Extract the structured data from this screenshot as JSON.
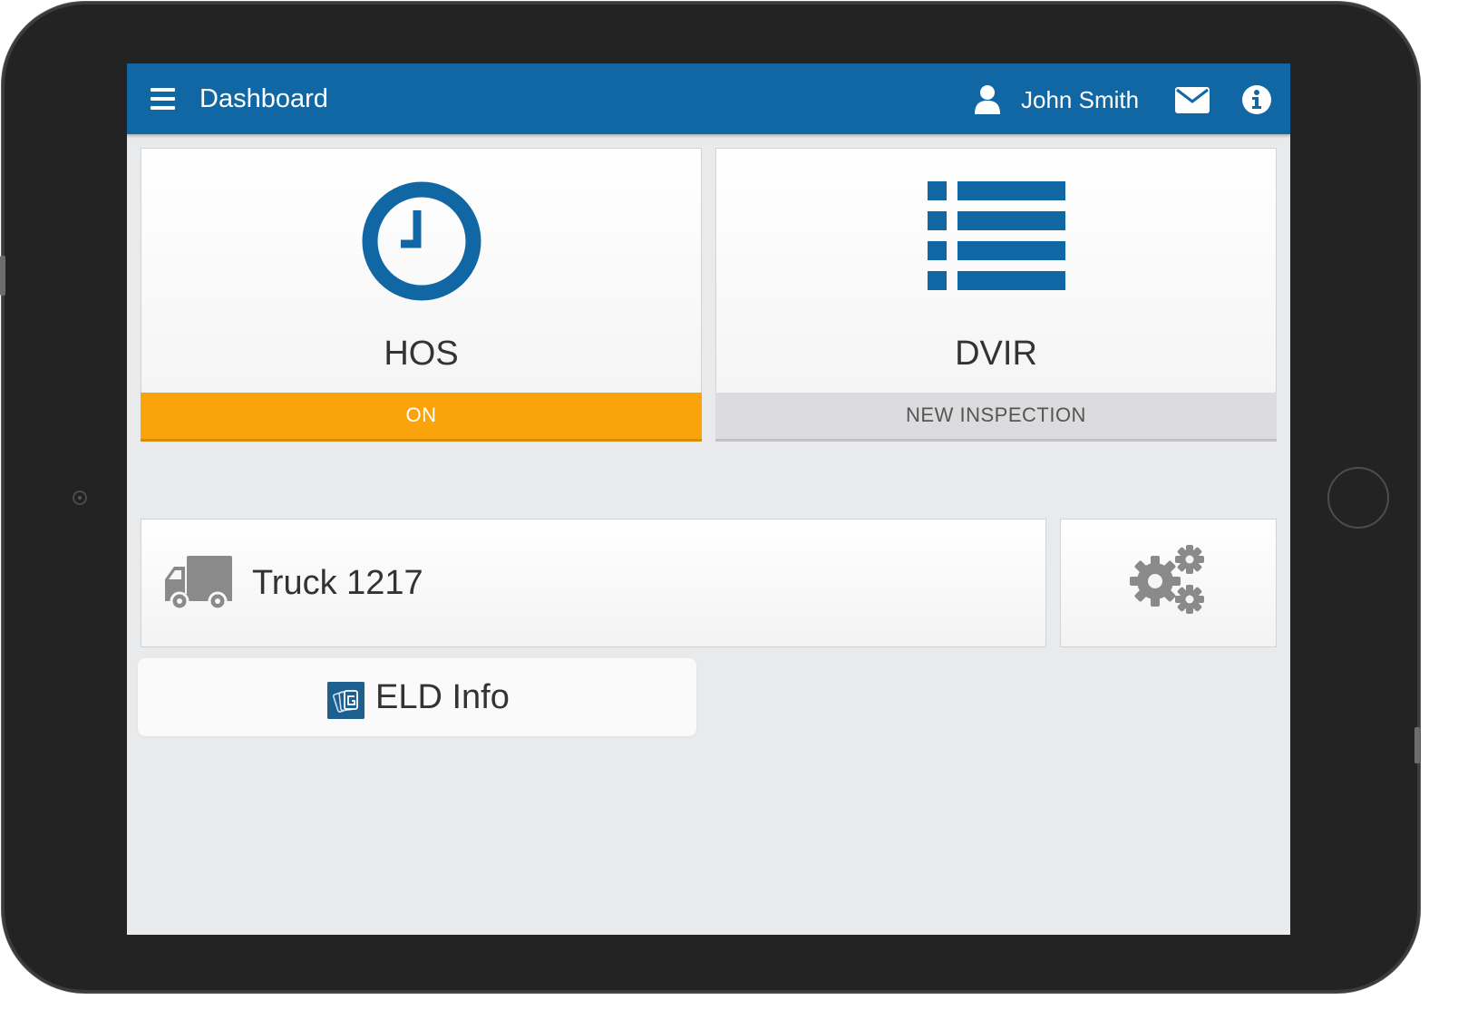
{
  "header": {
    "title": "Dashboard",
    "user_name": "John Smith",
    "icons": [
      "menu-icon",
      "user-icon",
      "mail-icon",
      "info-icon"
    ]
  },
  "tiles": {
    "hos": {
      "label": "HOS",
      "status": "ON",
      "icon": "clock-icon"
    },
    "dvir": {
      "label": "DVIR",
      "status": "NEW INSPECTION",
      "icon": "list-icon"
    }
  },
  "vehicle": {
    "label": "Truck 1217",
    "icon": "truck-icon"
  },
  "settings": {
    "icon": "gears-icon"
  },
  "eld": {
    "label": "ELD Info",
    "icon": "eld-logo-icon"
  },
  "colors": {
    "header_bg": "#1167a4",
    "accent_blue": "#1167a4",
    "status_on": "#fba30a",
    "status_neutral": "#dcdcde",
    "icon_gray": "#8a8a8a",
    "screen_bg": "#e9eaec"
  }
}
